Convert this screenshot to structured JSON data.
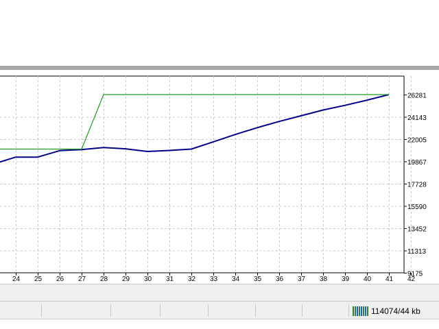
{
  "chart_data": {
    "type": "line",
    "x_ticks": [
      "24",
      "25",
      "26",
      "27",
      "28",
      "29",
      "30",
      "31",
      "32",
      "33",
      "34",
      "35",
      "36",
      "37",
      "38",
      "39",
      "40",
      "41",
      "42"
    ],
    "y_ticks": [
      "26281",
      "24143",
      "22005",
      "19867",
      "17728",
      "15590",
      "13452",
      "11313",
      "9175"
    ],
    "ylim": [
      9175,
      26281
    ],
    "grid": true,
    "series": [
      {
        "color": "#00008b",
        "points": [
          [
            22.8,
            19500
          ],
          [
            24.0,
            20280
          ],
          [
            25.0,
            20280
          ],
          [
            26.0,
            20900
          ],
          [
            27.0,
            21000
          ],
          [
            28.0,
            21200
          ],
          [
            29.0,
            21080
          ],
          [
            30.0,
            20820
          ],
          [
            31.0,
            20920
          ],
          [
            32.0,
            21050
          ],
          [
            33.0,
            21750
          ],
          [
            34.0,
            22450
          ],
          [
            35.0,
            23100
          ],
          [
            36.0,
            23700
          ],
          [
            37.0,
            24250
          ],
          [
            38.0,
            24800
          ],
          [
            39.0,
            25250
          ],
          [
            40.0,
            25750
          ],
          [
            41.0,
            26281
          ]
        ]
      },
      {
        "color": "#1e9a1e",
        "points": [
          [
            22.8,
            21050
          ],
          [
            27.0,
            21050
          ],
          [
            28.0,
            26281
          ],
          [
            41.0,
            26281
          ]
        ]
      }
    ],
    "colors": {
      "grid": "#c8c8c8",
      "axis": "#000000"
    }
  },
  "status_bar": {
    "traffic": "114074/44 kb",
    "icon": "network-traffic-icon"
  }
}
